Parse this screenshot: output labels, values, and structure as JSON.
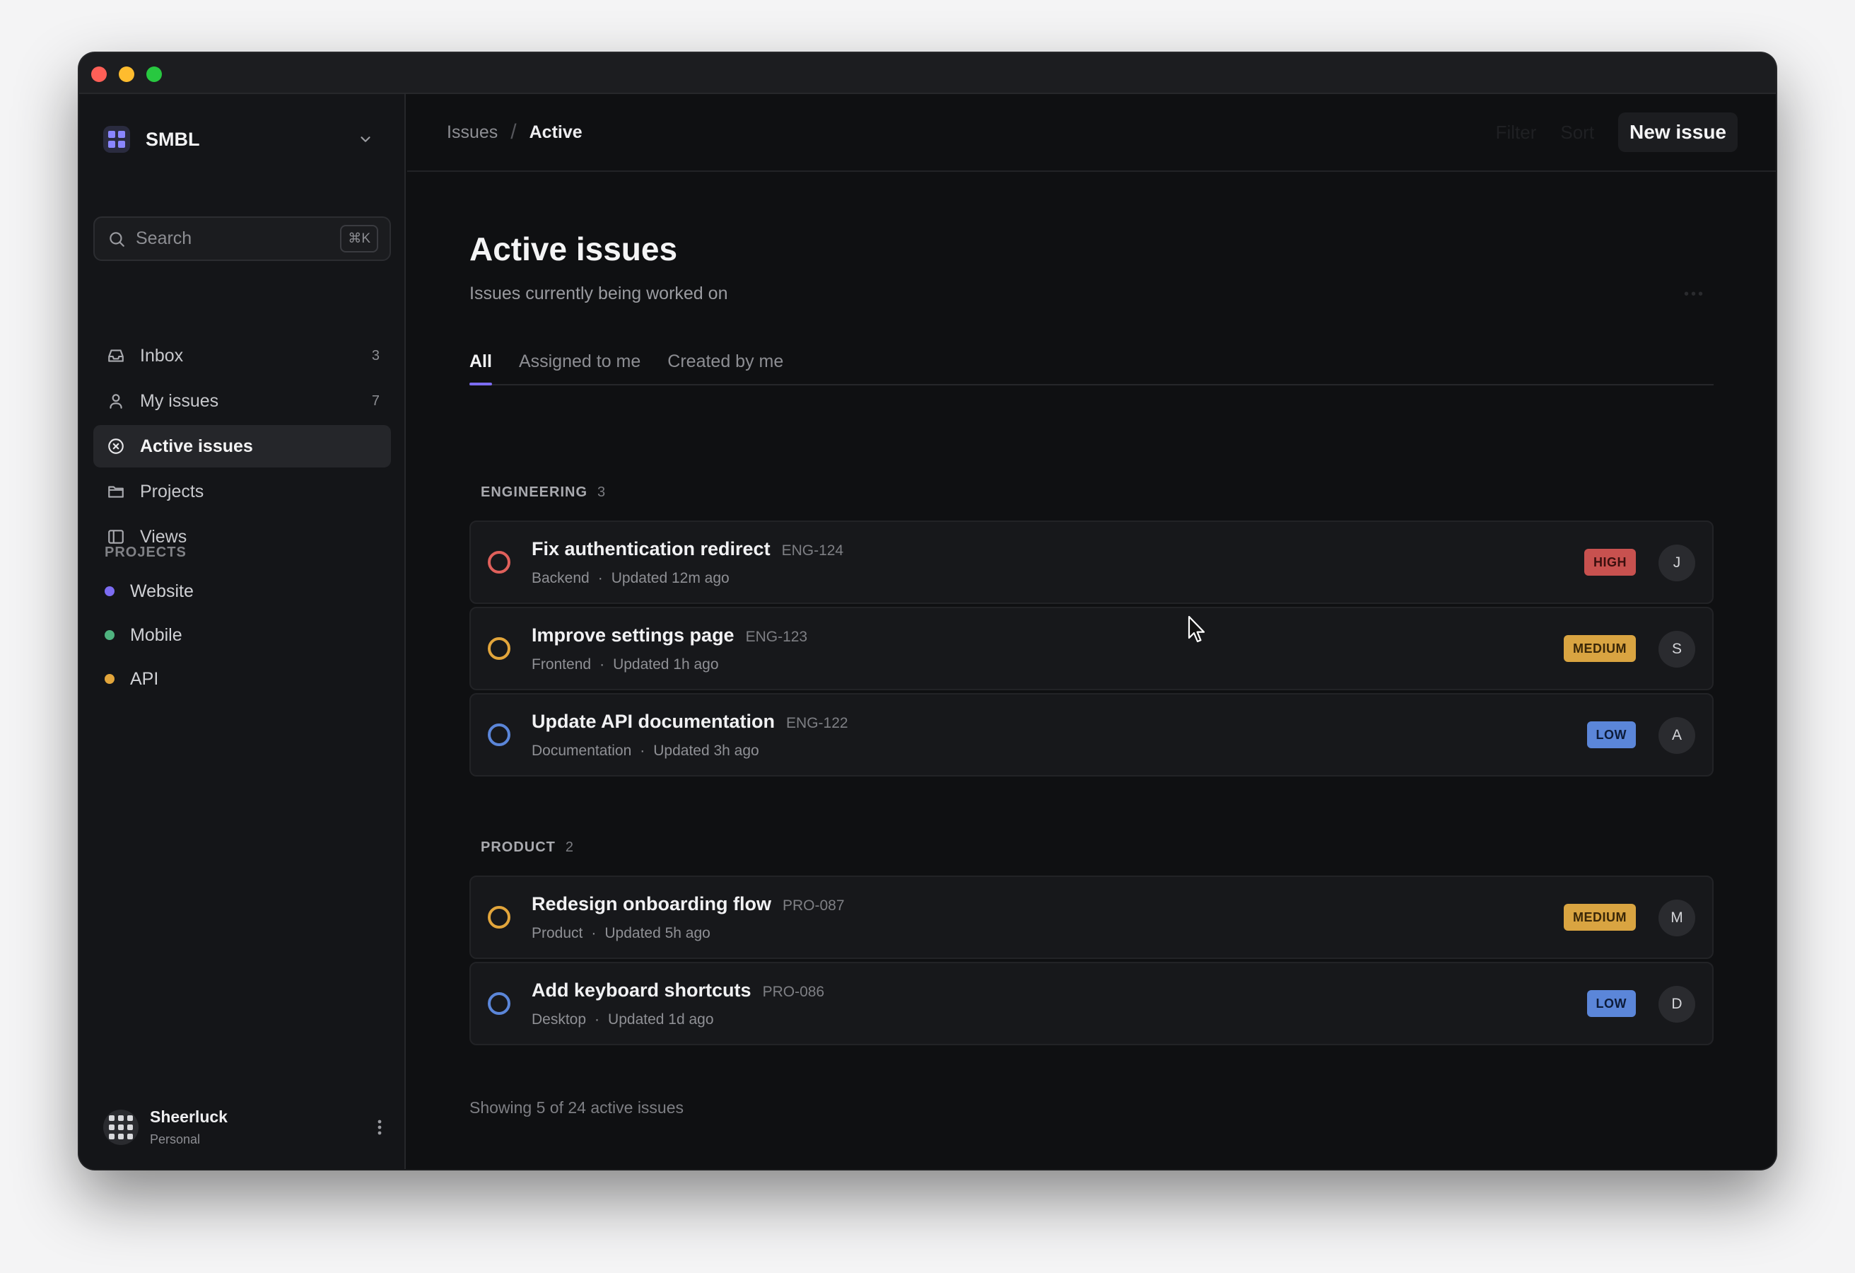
{
  "workspace": {
    "name": "SMBL"
  },
  "search": {
    "placeholder": "Search",
    "shortcut": "⌘K"
  },
  "nav": [
    {
      "label": "Inbox",
      "count": "3",
      "icon": "inbox-icon"
    },
    {
      "label": "My issues",
      "count": "7",
      "icon": "user-icon"
    },
    {
      "label": "Active issues",
      "count": "",
      "icon": "circle-x-icon",
      "active": true
    },
    {
      "label": "Projects",
      "count": "",
      "icon": "folder-icon"
    },
    {
      "label": "Views",
      "count": "",
      "icon": "panel-icon"
    }
  ],
  "projects": {
    "title": "PROJECTS",
    "items": [
      {
        "label": "Website",
        "color": "#7c6cf2"
      },
      {
        "label": "Mobile",
        "color": "#4fb37f"
      },
      {
        "label": "API",
        "color": "#e2a53b"
      }
    ]
  },
  "user": {
    "name": "Sheerluck",
    "plan": "Personal"
  },
  "breadcrumb": {
    "parent": "Issues",
    "current": "Active"
  },
  "toolbar": {
    "filter": "Filter",
    "sort": "Sort",
    "new_issue": "New issue"
  },
  "page": {
    "title": "Active issues",
    "subtitle": "Issues currently being worked on"
  },
  "tabs": [
    "All",
    "Assigned to me",
    "Created by me"
  ],
  "groups": [
    {
      "name": "ENGINEERING",
      "count": "3",
      "issues": [
        {
          "title": "Fix authentication redirect",
          "id": "ENG-124",
          "area": "Backend",
          "updated": "Updated 12m ago",
          "priority": "HIGH",
          "assignee": "J",
          "status_color": "#e0605b"
        },
        {
          "title": "Improve settings page",
          "id": "ENG-123",
          "area": "Frontend",
          "updated": "Updated 1h ago",
          "priority": "MEDIUM",
          "assignee": "S",
          "status_color": "#e2a53b"
        },
        {
          "title": "Update API documentation",
          "id": "ENG-122",
          "area": "Documentation",
          "updated": "Updated 3h ago",
          "priority": "LOW",
          "assignee": "A",
          "status_color": "#5b86d9"
        }
      ]
    },
    {
      "name": "PRODUCT",
      "count": "2",
      "issues": [
        {
          "title": "Redesign onboarding flow",
          "id": "PRO-087",
          "area": "Product",
          "updated": "Updated 5h ago",
          "priority": "MEDIUM",
          "assignee": "M",
          "status_color": "#e2a53b"
        },
        {
          "title": "Add keyboard shortcuts",
          "id": "PRO-086",
          "area": "Desktop",
          "updated": "Updated 1d ago",
          "priority": "LOW",
          "assignee": "D",
          "status_color": "#5b86d9"
        }
      ]
    }
  ],
  "priority_colors": {
    "HIGH": {
      "bg": "#c8514f",
      "fg": "#3a0f0e"
    },
    "MEDIUM": {
      "bg": "#d9a441",
      "fg": "#3a2708"
    },
    "LOW": {
      "bg": "#5b86d9",
      "fg": "#0d1c3a"
    }
  },
  "footer": "Showing 5 of 24 active issues"
}
